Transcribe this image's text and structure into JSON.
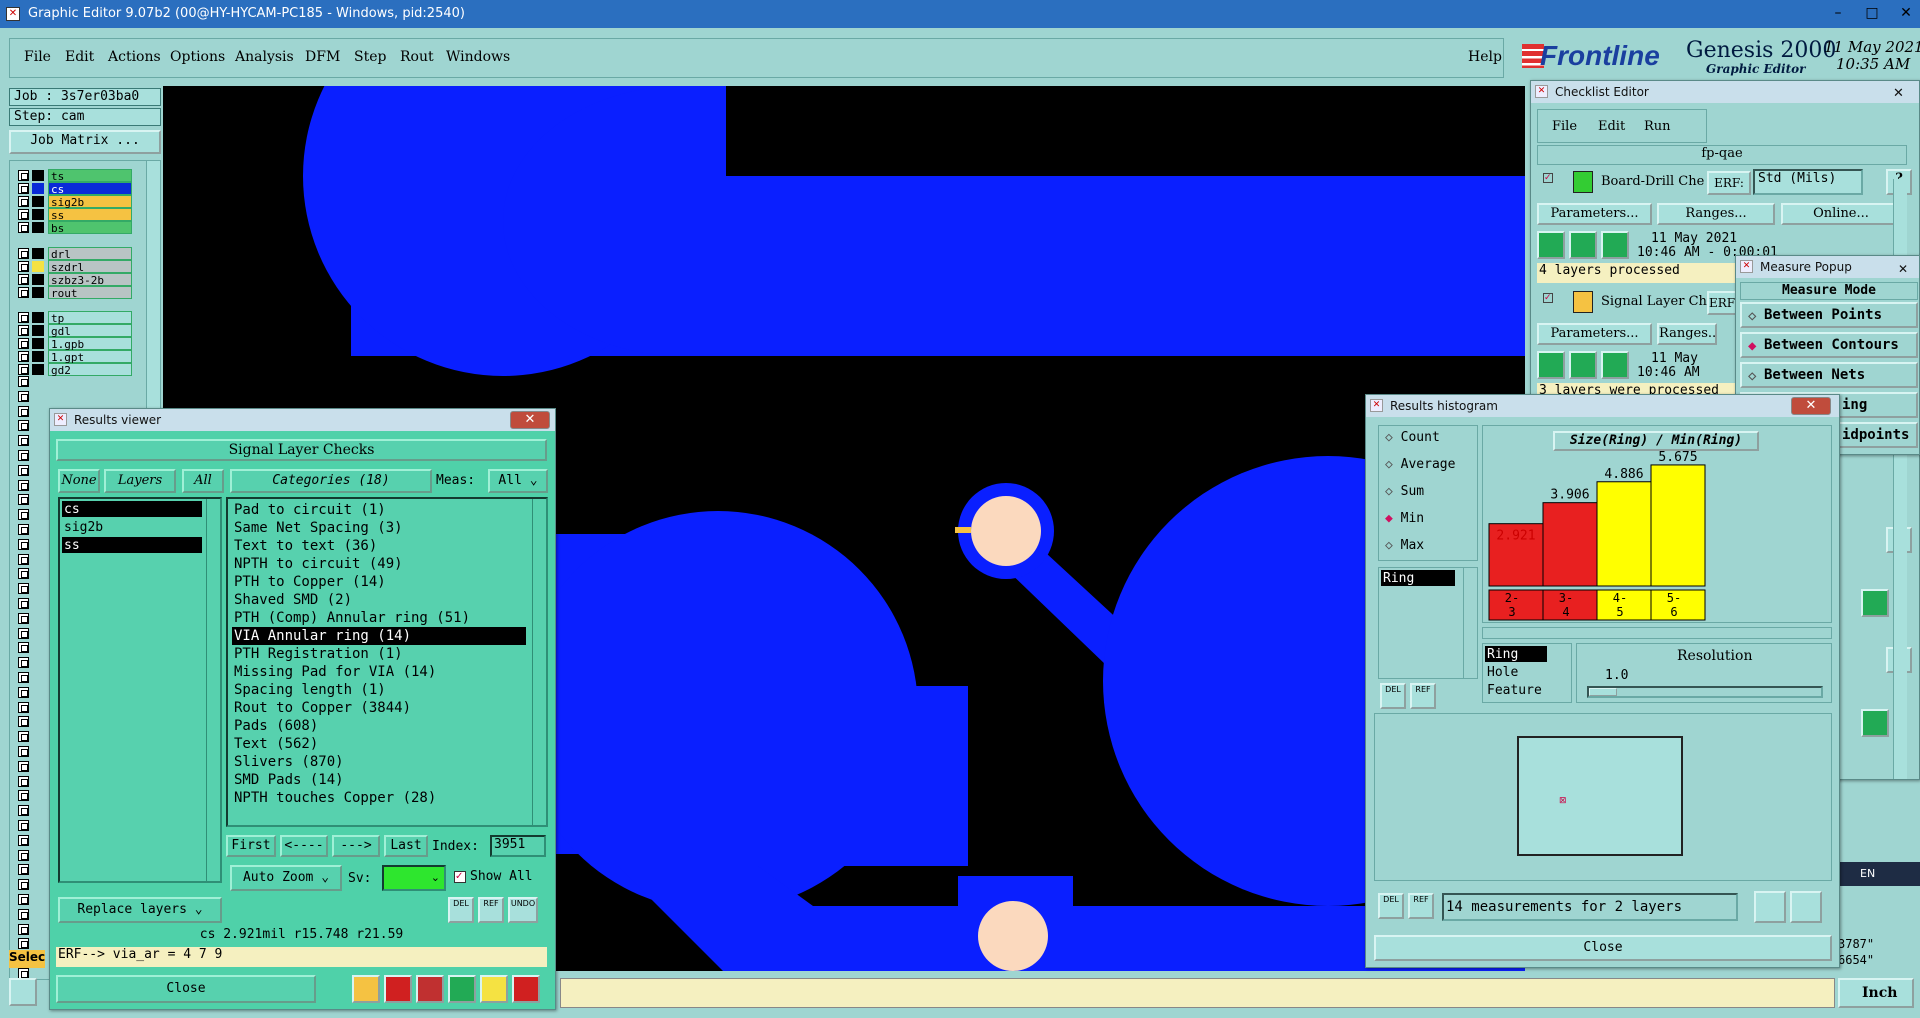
{
  "window": {
    "title": "Graphic Editor 9.07b2 (00@HY-HYCAM-PC185 - Windows, pid:2540)"
  },
  "menu": {
    "items": [
      "File",
      "Edit",
      "Actions",
      "Options",
      "Analysis",
      "DFM",
      "Step",
      "Rout",
      "Windows"
    ],
    "help": "Help"
  },
  "brand": {
    "logo": "Frontline",
    "product": "Genesis 2000",
    "subtitle": "Graphic Editor",
    "date": "11 May 2021",
    "time": "10:35 AM"
  },
  "job": {
    "job_label": "Job : 3s7er03ba0",
    "step_label": "Step: cam",
    "matrix_button": "Job Matrix ..."
  },
  "layers": [
    {
      "name": "ts",
      "color": "#4fc46e"
    },
    {
      "name": "cs",
      "color": "#0a2ad8"
    },
    {
      "name": "sig2b",
      "color": "#f5c242"
    },
    {
      "name": "ss",
      "color": "#f5c242"
    },
    {
      "name": "bs",
      "color": "#4fc46e"
    },
    {
      "name": "drl",
      "color": "#b8c4c4"
    },
    {
      "name": "szdrl",
      "color": "#b8c4c4"
    },
    {
      "name": "szbz3-2b",
      "color": "#b8c4c4"
    },
    {
      "name": "rout",
      "color": "#b8c4c4"
    },
    {
      "name": "tp",
      "color": "#a8e0dc"
    },
    {
      "name": "gdl",
      "color": "#a8e0dc"
    },
    {
      "name": "1.gpb",
      "color": "#a8e0dc"
    },
    {
      "name": "1.gpt",
      "color": "#a8e0dc"
    },
    {
      "name": "gd2",
      "color": "#a8e0dc"
    }
  ],
  "results_viewer": {
    "title": "Results viewer",
    "header": "Signal Layer Checks",
    "tabs": [
      "None",
      "Layers",
      "All"
    ],
    "layer_list": [
      "cs",
      "sig2b",
      "ss"
    ],
    "categories_label": "Categories (18)",
    "meas_label": "Meas:",
    "meas_value": "All",
    "categories": [
      "Pad to circuit (1)",
      "Same Net Spacing (3)",
      "Text to text (36)",
      "NPTH to circuit (49)",
      "PTH to Copper (14)",
      "Shaved SMD (2)",
      "PTH (Comp) Annular ring (51)",
      "VIA Annular ring (14)",
      "PTH Registration (1)",
      "Missing Pad for VIA (14)",
      "Spacing length (1)",
      "Rout to Copper (3844)",
      "Pads (608)",
      "Text (562)",
      "Slivers (870)",
      "SMD Pads (14)",
      "NPTH touches Copper (28)"
    ],
    "nav": [
      "First",
      "<----",
      "--->",
      "Last"
    ],
    "index_label": "Index:",
    "index_value": "3951",
    "auto_zoom": "Auto Zoom",
    "sv_label": "Sv:",
    "show_all": "Show All",
    "replace_layers": "Replace layers",
    "status_line": "cs 2.921mil  r15.748  r21.59",
    "erf_line": "ERF--> via_ar = 4 7 9",
    "close": "Close",
    "del": "DEL",
    "ref": "REF",
    "undo": "UNDO"
  },
  "checklist": {
    "title": "Checklist Editor",
    "menu": [
      "File",
      "Edit",
      "Run"
    ],
    "name": "fp-qae",
    "items": [
      {
        "name": "Board-Drill Che",
        "erf": "ERF:",
        "erf_value": "Std (Mils)",
        "date": "11 May 2021",
        "time": "10:46 AM - 0:00:01",
        "status": "4 layers processed"
      },
      {
        "name": "Signal Layer Ch",
        "erf": "ERF",
        "date": "11 May",
        "time": "10:46 AM",
        "status": "3 layers were processed"
      }
    ],
    "buttons": [
      "Parameters...",
      "Ranges...",
      "Online..."
    ]
  },
  "measure_popup": {
    "title": "Measure Popup",
    "mode_label": "Measure Mode",
    "options": [
      "Between Points",
      "Between Contours",
      "Between Nets"
    ],
    "selected": "Between Contours",
    "partial": [
      "ing",
      "idpoints"
    ]
  },
  "histogram": {
    "title": "Results histogram",
    "modes": [
      "Count",
      "Average",
      "Sum",
      "Min",
      "Max"
    ],
    "selected_mode": "Min",
    "list": [
      "Ring"
    ],
    "chart_title": "Size(Ring) / Min(Ring)",
    "bars": [
      {
        "bin": "2-3",
        "value": 2.921,
        "color": "#e82020"
      },
      {
        "bin": "3-4",
        "value": 3.906,
        "color": "#e82020"
      },
      {
        "bin": "4-5",
        "value": 4.886,
        "color": "#ffff00"
      },
      {
        "bin": "5-6",
        "value": 5.675,
        "color": "#ffff00"
      }
    ],
    "value_labels": [
      "2.921",
      "3.906",
      "4.886",
      "5.675"
    ],
    "bin_labels": [
      [
        "2-",
        "3"
      ],
      [
        "3-",
        "4"
      ],
      [
        "4-",
        "5"
      ],
      [
        "5-",
        "6"
      ]
    ],
    "attr_list": [
      "Ring",
      "Hole",
      "Feature"
    ],
    "resolution_label": "Resolution",
    "resolution_value": "1.0",
    "summary": "14 measurements for 2 layers",
    "close": "Close",
    "del": "DEL",
    "ref": "REF"
  },
  "status_bar": {
    "units": "Inch",
    "coord1": "3787\"",
    "coord2": "6654\"",
    "lang": "EN",
    "select": "Selec"
  }
}
